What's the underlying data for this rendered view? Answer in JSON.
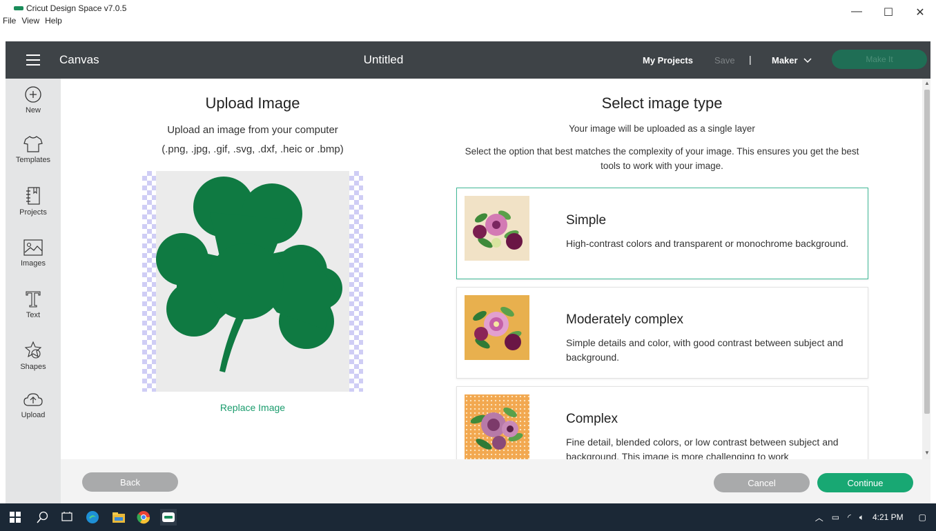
{
  "window": {
    "title": "Cricut Design Space  v7.0.5",
    "menu": [
      "File",
      "View",
      "Help"
    ],
    "controls": {
      "minimize": "—",
      "maximize": "☐",
      "close": "✕"
    }
  },
  "header": {
    "section": "Canvas",
    "document_title": "Untitled",
    "my_projects": "My Projects",
    "save": "Save",
    "divider": "|",
    "machine": "Maker",
    "make_it": "Make It"
  },
  "toolbar": {
    "items": [
      {
        "label": "New",
        "icon": "plus-circle-icon"
      },
      {
        "label": "Templates",
        "icon": "shirt-icon"
      },
      {
        "label": "Projects",
        "icon": "notebook-icon"
      },
      {
        "label": "Images",
        "icon": "image-icon"
      },
      {
        "label": "Text",
        "icon": "text-t-icon"
      },
      {
        "label": "Shapes",
        "icon": "shapes-icon"
      },
      {
        "label": "Upload",
        "icon": "cloud-upload-icon"
      }
    ]
  },
  "upload": {
    "title": "Upload Image",
    "subtitle": "Upload an image from your computer",
    "formats": "(.png, .jpg, .gif, .svg, .dxf, .heic or .bmp)",
    "replace": "Replace Image",
    "image_color": "#0f7a42"
  },
  "select": {
    "title": "Select image type",
    "subtitle": "Your image will be uploaded as a single layer",
    "instructions": "Select the option that best matches the complexity of your image. This ensures you get the best tools to work with your image.",
    "types": [
      {
        "name": "Simple",
        "description": "High-contrast colors and transparent or monochrome background.",
        "selected": true
      },
      {
        "name": "Moderately complex",
        "description": "Simple details and color, with good contrast between subject and background.",
        "selected": false
      },
      {
        "name": "Complex",
        "description": "Fine detail, blended colors, or low contrast between subject and background. This image is more challenging to work",
        "selected": false
      }
    ]
  },
  "footer": {
    "back": "Back",
    "cancel": "Cancel",
    "continue": "Continue"
  },
  "taskbar": {
    "time": "4:21 PM"
  },
  "colors": {
    "header_bg": "#3e4347",
    "accent_green": "#18a873",
    "selected_border": "#3fb896"
  }
}
